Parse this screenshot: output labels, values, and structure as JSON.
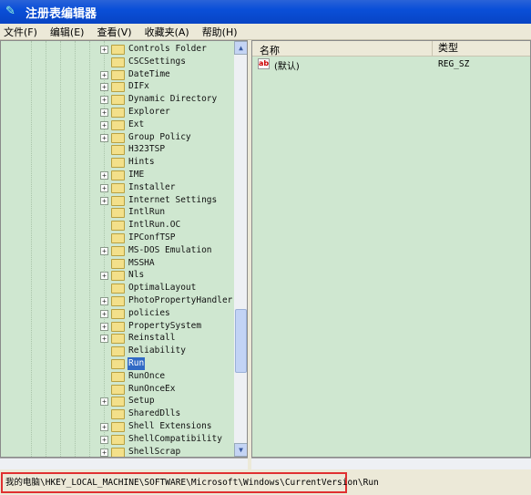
{
  "window": {
    "title": "注册表编辑器",
    "icon": "regedit-icon"
  },
  "menu": [
    "文件(F)",
    "编辑(E)",
    "查看(V)",
    "收藏夹(A)",
    "帮助(H)"
  ],
  "tree": {
    "items": [
      {
        "label": "Controls Folder",
        "expandable": true
      },
      {
        "label": "CSCSettings",
        "expandable": false
      },
      {
        "label": "DateTime",
        "expandable": true
      },
      {
        "label": "DIFx",
        "expandable": true
      },
      {
        "label": "Dynamic Directory",
        "expandable": true
      },
      {
        "label": "Explorer",
        "expandable": true
      },
      {
        "label": "Ext",
        "expandable": true
      },
      {
        "label": "Group Policy",
        "expandable": true
      },
      {
        "label": "H323TSP",
        "expandable": false
      },
      {
        "label": "Hints",
        "expandable": false
      },
      {
        "label": "IME",
        "expandable": true
      },
      {
        "label": "Installer",
        "expandable": true
      },
      {
        "label": "Internet Settings",
        "expandable": true
      },
      {
        "label": "IntlRun",
        "expandable": false
      },
      {
        "label": "IntlRun.OC",
        "expandable": false
      },
      {
        "label": "IPConfTSP",
        "expandable": false
      },
      {
        "label": "MS-DOS Emulation",
        "expandable": true
      },
      {
        "label": "MSSHA",
        "expandable": false
      },
      {
        "label": "Nls",
        "expandable": true
      },
      {
        "label": "OptimalLayout",
        "expandable": false
      },
      {
        "label": "PhotoPropertyHandler",
        "expandable": true
      },
      {
        "label": "policies",
        "expandable": true
      },
      {
        "label": "PropertySystem",
        "expandable": true
      },
      {
        "label": "Reinstall",
        "expandable": true
      },
      {
        "label": "Reliability",
        "expandable": false
      },
      {
        "label": "Run",
        "expandable": false,
        "selected": true
      },
      {
        "label": "RunOnce",
        "expandable": false
      },
      {
        "label": "RunOnceEx",
        "expandable": false
      },
      {
        "label": "Setup",
        "expandable": true
      },
      {
        "label": "SharedDlls",
        "expandable": false
      },
      {
        "label": "Shell Extensions",
        "expandable": true
      },
      {
        "label": "ShellCompatibility",
        "expandable": true
      },
      {
        "label": "ShellScrap",
        "expandable": true
      }
    ]
  },
  "values": {
    "columns": [
      "名称",
      "类型"
    ],
    "rows": [
      {
        "name": "(默认)",
        "type": "REG_SZ",
        "icon": "string-value-icon"
      }
    ]
  },
  "status": {
    "path": "我的电脑\\HKEY_LOCAL_MACHINE\\SOFTWARE\\Microsoft\\Windows\\CurrentVersion\\Run",
    "highlight_color": "#e03030"
  }
}
